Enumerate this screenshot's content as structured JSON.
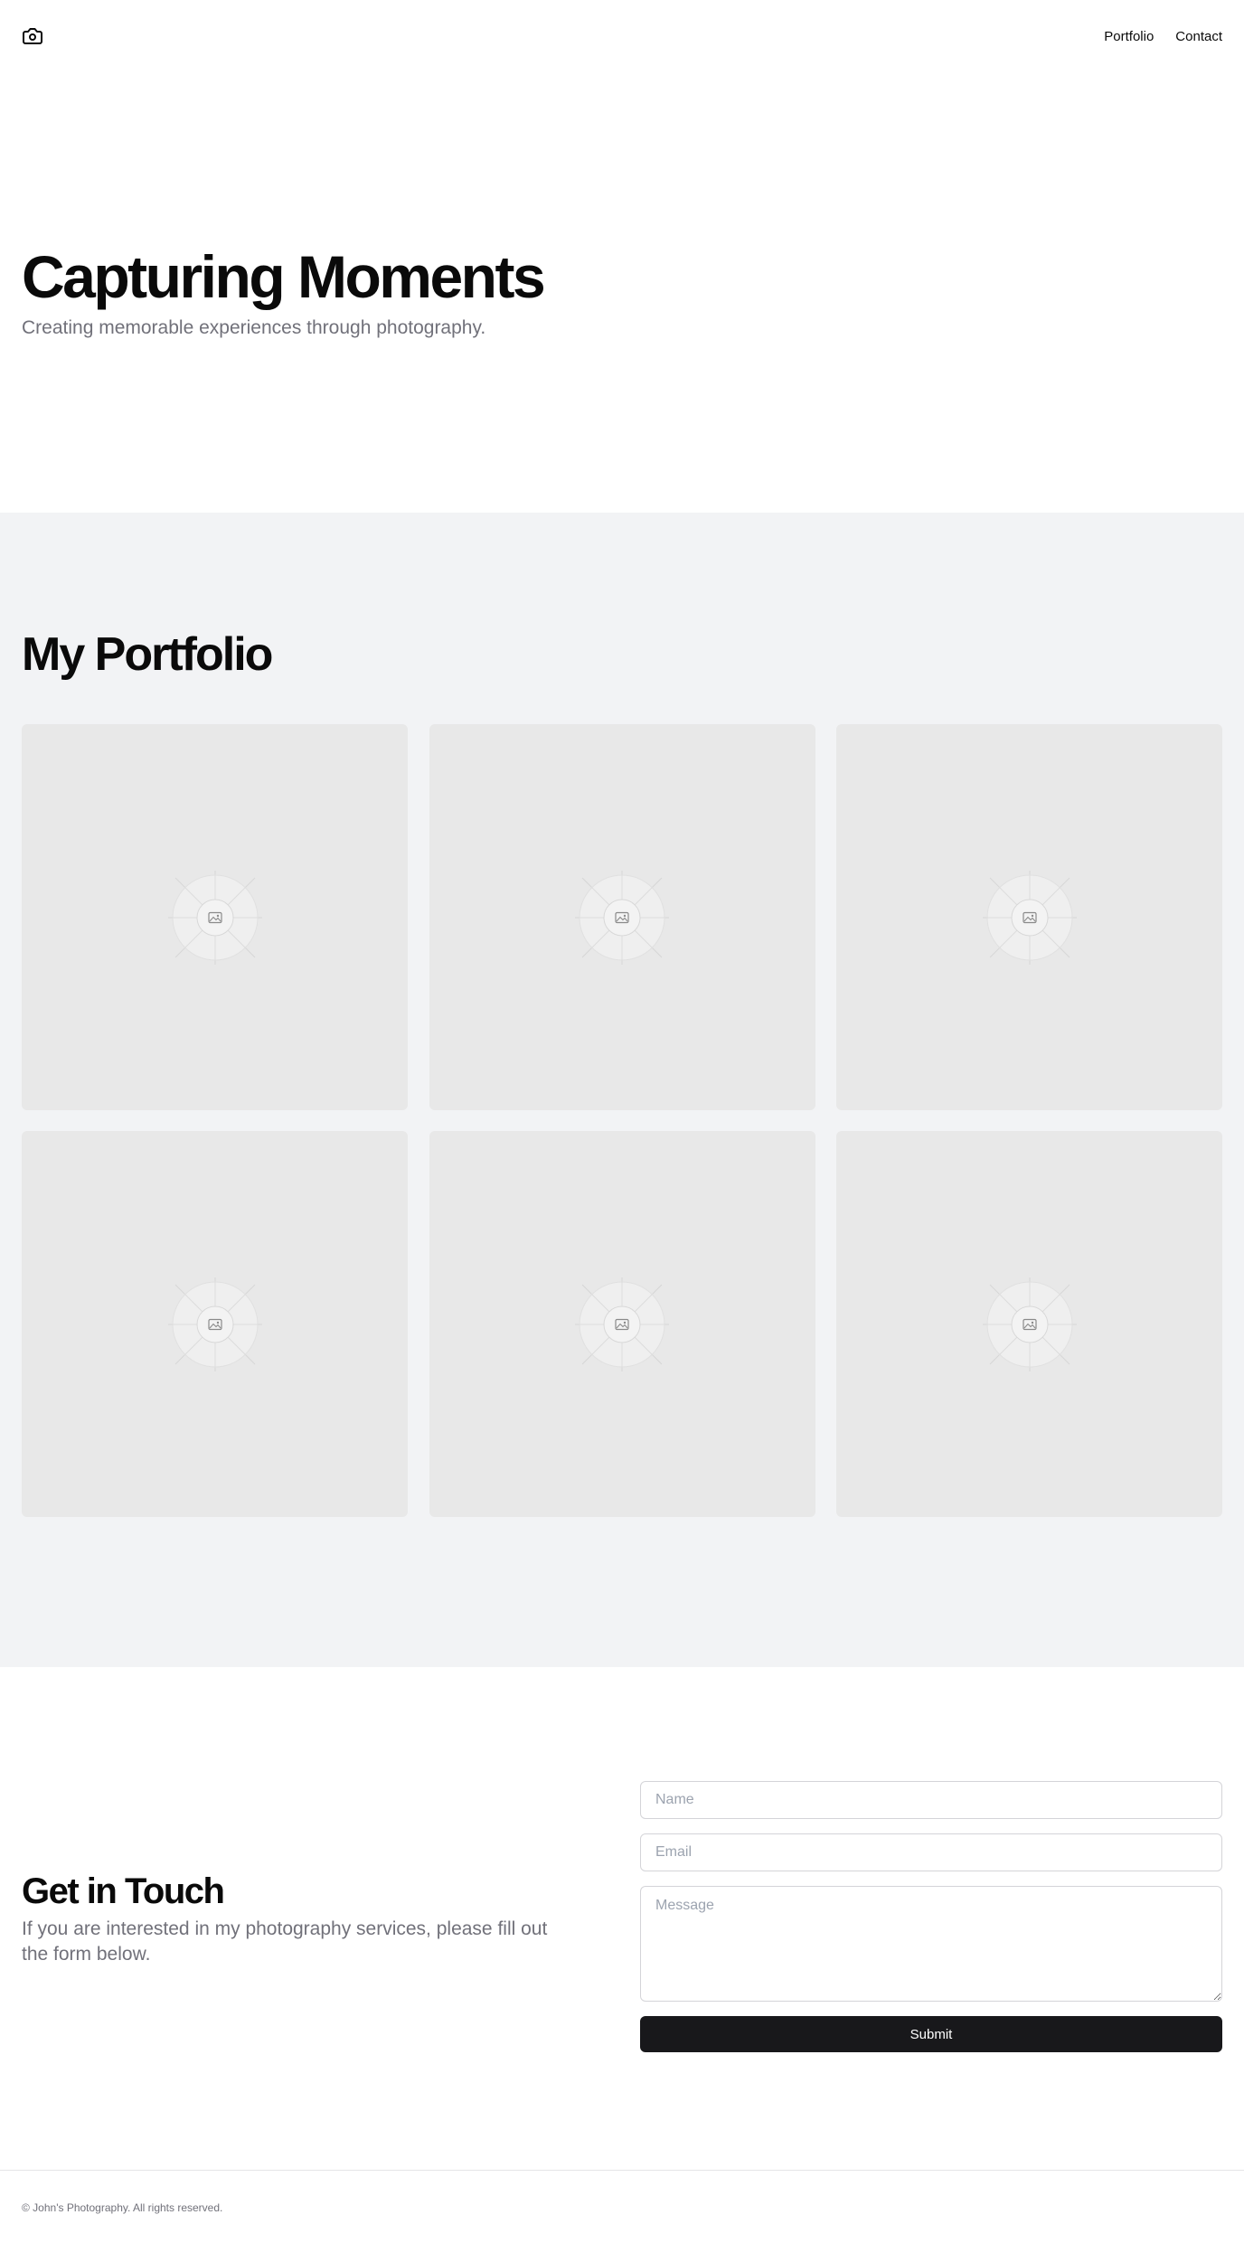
{
  "header": {
    "logo_icon": "camera-icon",
    "nav": [
      {
        "label": "Portfolio"
      },
      {
        "label": "Contact"
      }
    ]
  },
  "hero": {
    "title": "Capturing Moments",
    "subtitle": "Creating memorable experiences through photography."
  },
  "portfolio": {
    "title": "My Portfolio",
    "items": [
      {
        "icon": "image-placeholder-icon"
      },
      {
        "icon": "image-placeholder-icon"
      },
      {
        "icon": "image-placeholder-icon"
      },
      {
        "icon": "image-placeholder-icon"
      },
      {
        "icon": "image-placeholder-icon"
      },
      {
        "icon": "image-placeholder-icon"
      }
    ]
  },
  "contact": {
    "title": "Get in Touch",
    "description": "If you are interested in my photography services, please fill out the form below.",
    "form": {
      "name_placeholder": "Name",
      "email_placeholder": "Email",
      "message_placeholder": "Message",
      "submit_label": "Submit"
    }
  },
  "footer": {
    "copyright": "© John's Photography. All rights reserved."
  },
  "colors": {
    "text": "#0a0a0a",
    "muted": "#71717a",
    "section_bg": "#f2f3f5",
    "tile_bg": "#e8e8e8",
    "button_bg": "#18181b",
    "border": "#d4d4d8"
  }
}
